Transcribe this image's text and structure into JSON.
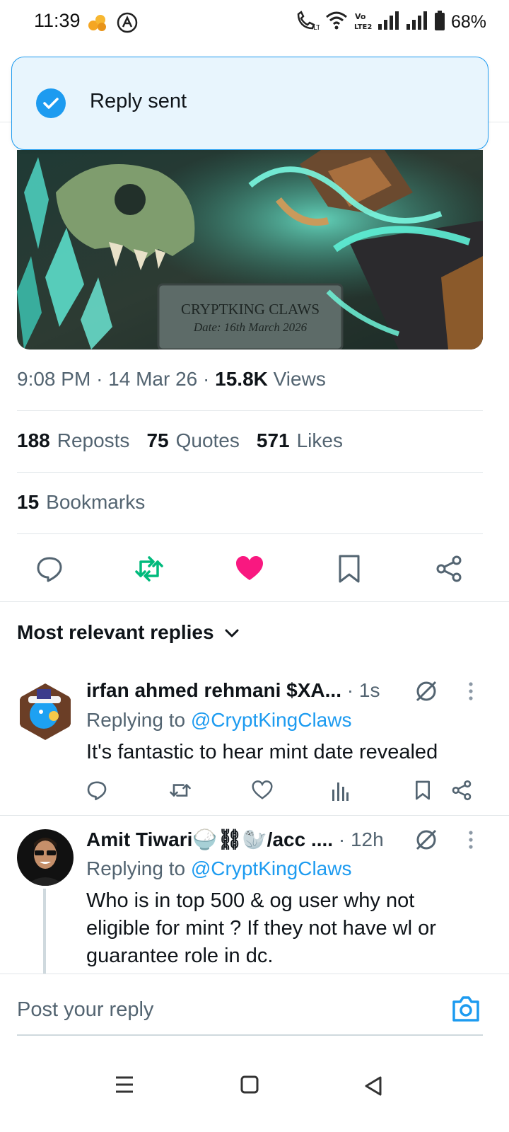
{
  "status_bar": {
    "time": "11:39",
    "battery": "68%",
    "icons": [
      "game-notification-icon",
      "assistant-icon",
      "wifi-calling-icon",
      "wifi-icon",
      "volte-icon",
      "signal-icon",
      "signal-icon",
      "battery-icon"
    ]
  },
  "toast": {
    "message": "Reply sent",
    "icon": "check-circle-icon",
    "accent": "#1d9bf0"
  },
  "media": {
    "caption_line1": "CRYPTKING CLAWS",
    "caption_line2": "Date: 16th March 2026"
  },
  "post_meta": {
    "time": "9:08 PM",
    "date": "14 Mar 26",
    "views_count": "15.8K",
    "views_label": "Views"
  },
  "stats": {
    "reposts_count": "188",
    "reposts_label": "Reposts",
    "quotes_count": "75",
    "quotes_label": "Quotes",
    "likes_count": "571",
    "likes_label": "Likes",
    "bookmarks_count": "15",
    "bookmarks_label": "Bookmarks"
  },
  "actions": [
    "reply-icon",
    "repost-icon",
    "like-icon",
    "bookmark-icon",
    "share-icon"
  ],
  "colors": {
    "repost_active": "#00ba7c",
    "like_active": "#f91880",
    "link": "#1d9bf0",
    "secondary_text": "#536471"
  },
  "replies": {
    "sort_label": "Most relevant replies",
    "items": [
      {
        "name": "irfan ahmed rehmani $XA...",
        "time": "· 1s",
        "replying_prefix": "Replying to",
        "handle": "@CryptKingClaws",
        "text": "It's fantastic to hear mint date revealed"
      },
      {
        "name": "Amit Tiwari🍚⛓🦭/acc ....",
        "time": "· 12h",
        "replying_prefix": "Replying to",
        "handle": "@CryptKingClaws",
        "text": "Who is in top 500 & og user why not eligible for mint ? If they not have wl or guarantee role in dc."
      }
    ]
  },
  "composer": {
    "placeholder": "Post your reply"
  }
}
